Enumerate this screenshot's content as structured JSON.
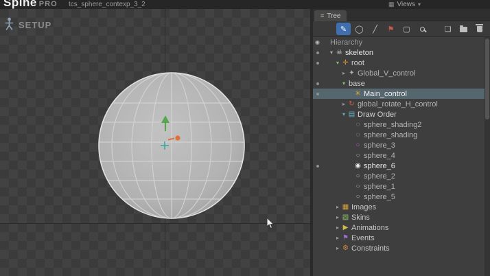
{
  "app": {
    "logo": "Spine",
    "logo_badge": "PRO",
    "filename": "tcs_sphere_contexp_3_2",
    "mode_label": "SETUP",
    "views_label": "Views"
  },
  "viewport": {
    "gizmo_colors": {
      "y_axis_handle": "#57a74f",
      "x_axis_handle": "#e0703a",
      "center_handle": "#3fa7a0"
    },
    "selection_highlight": "#56666f"
  },
  "tree_panel": {
    "tab_label": "Tree",
    "icon_glyphs": {
      "eye": "◉",
      "skeleton": "☠",
      "root-cross": "✛",
      "control-star": "✳",
      "control-small": "✦",
      "rotate-control": "↻",
      "draw-order": "▤",
      "mesh": "◌",
      "circle": "○",
      "circle-filled": "◉",
      "images": "▦",
      "skins": "▧",
      "animations": "▶",
      "events": "⚑",
      "constraints": "⚙",
      "expander-down": "▾",
      "expander-right": "▸"
    },
    "toolbar": {
      "left": [
        {
          "name": "brush-tool",
          "glyph": "✎",
          "active": true,
          "color": "#ffffff"
        },
        {
          "name": "weights-tool",
          "glyph": "◯"
        },
        {
          "name": "create-tool",
          "glyph": "╱"
        },
        {
          "name": "flag-tool",
          "glyph": "⚑",
          "color": "#c75a50"
        },
        {
          "name": "box-select-tool",
          "glyph": "▢"
        },
        {
          "name": "search-tool",
          "shape": "mag"
        }
      ],
      "right": [
        {
          "name": "new-button",
          "glyph": "❏"
        },
        {
          "name": "folder-button",
          "shape": "folder"
        },
        {
          "name": "trash-button",
          "shape": "trash"
        }
      ]
    },
    "rows": [
      {
        "label": "Hierarchy",
        "level": 0,
        "gutter": "eye",
        "expander": "",
        "icon": "",
        "color": "#9f9f9f"
      },
      {
        "label": "skeleton",
        "level": 1,
        "gutter": "dot",
        "expander": "down",
        "expander_color": "#b0b0b0",
        "icon": "skeleton",
        "icon_color": "#d8d8d8",
        "color": "#e4e4e4"
      },
      {
        "label": "root",
        "level": 2,
        "gutter": "dot",
        "expander": "down",
        "expander_color": "#8bbf67",
        "icon": "root-cross",
        "icon_color": "#e0973f",
        "color": "#cfcfcf"
      },
      {
        "label": "Global_V_control",
        "level": 3,
        "gutter": "",
        "expander": "right",
        "expander_color": "#9a9a9a",
        "icon": "control-small",
        "icon_color": "#b0b0b0",
        "color": "#b4b4b4"
      },
      {
        "label": "base",
        "level": 3,
        "gutter": "dot",
        "expander": "down",
        "expander_color": "#8bbf67",
        "icon": "",
        "color": "#cfcfcf"
      },
      {
        "label": "Main_control",
        "level": 4,
        "gutter": "dot",
        "expander": "",
        "icon": "control-star",
        "icon_color": "#d9b13b",
        "color": "#f2f2f2",
        "selected": true
      },
      {
        "label": "global_rotate_H_control",
        "level": 3,
        "gutter": "",
        "expander": "right",
        "expander_color": "#9a9a9a",
        "icon": "rotate-control",
        "icon_color": "#cc5f4a",
        "color": "#b4b4b4"
      },
      {
        "label": "Draw Order",
        "level": 3,
        "gutter": "",
        "expander": "down",
        "expander_color": "#62aec4",
        "icon": "draw-order",
        "icon_color": "#62aec4",
        "color": "#d8d8d8"
      },
      {
        "label": "sphere_shading2",
        "level": 4,
        "gutter": "",
        "expander": "",
        "icon": "mesh",
        "icon_color": "#b0b0b0",
        "color": "#b4b4b4"
      },
      {
        "label": "sphere_shading",
        "level": 4,
        "gutter": "",
        "expander": "",
        "icon": "mesh",
        "icon_color": "#b0b0b0",
        "color": "#b4b4b4"
      },
      {
        "label": "sphere_3",
        "level": 4,
        "gutter": "",
        "expander": "",
        "icon": "circle",
        "icon_color": "#c75fc0",
        "color": "#b4b4b4"
      },
      {
        "label": "sphere_4",
        "level": 4,
        "gutter": "",
        "expander": "",
        "icon": "circle",
        "icon_color": "#b0b0b0",
        "color": "#b4b4b4"
      },
      {
        "label": "sphere_6",
        "level": 4,
        "gutter": "dot",
        "expander": "",
        "icon": "circle-filled",
        "icon_color": "#e8e8e8",
        "color": "#e8e8e8"
      },
      {
        "label": "sphere_2",
        "level": 4,
        "gutter": "",
        "expander": "",
        "icon": "circle",
        "icon_color": "#b0b0b0",
        "color": "#b4b4b4"
      },
      {
        "label": "sphere_1",
        "level": 4,
        "gutter": "",
        "expander": "",
        "icon": "circle",
        "icon_color": "#b0b0b0",
        "color": "#b4b4b4"
      },
      {
        "label": "sphere_5",
        "level": 4,
        "gutter": "",
        "expander": "",
        "icon": "circle",
        "icon_color": "#b0b0b0",
        "color": "#b4b4b4"
      },
      {
        "label": "Images",
        "level": 2,
        "gutter": "",
        "expander": "right",
        "expander_color": "#9a9a9a",
        "icon": "images",
        "icon_color": "#d9a13c",
        "color": "#c6c6c6"
      },
      {
        "label": "Skins",
        "level": 2,
        "gutter": "",
        "expander": "right",
        "expander_color": "#9a9a9a",
        "icon": "skins",
        "icon_color": "#8bbf67",
        "color": "#c6c6c6"
      },
      {
        "label": "Animations",
        "level": 2,
        "gutter": "",
        "expander": "right",
        "expander_color": "#9a9a9a",
        "icon": "animations",
        "icon_color": "#cbbf4a",
        "color": "#c6c6c6"
      },
      {
        "label": "Events",
        "level": 2,
        "gutter": "",
        "expander": "right",
        "expander_color": "#9a9a9a",
        "icon": "events",
        "icon_color": "#9a6fd0",
        "color": "#c6c6c6"
      },
      {
        "label": "Constraints",
        "level": 2,
        "gutter": "",
        "expander": "right",
        "expander_color": "#9a9a9a",
        "icon": "constraints",
        "icon_color": "#d98a3c",
        "color": "#c6c6c6"
      }
    ]
  }
}
